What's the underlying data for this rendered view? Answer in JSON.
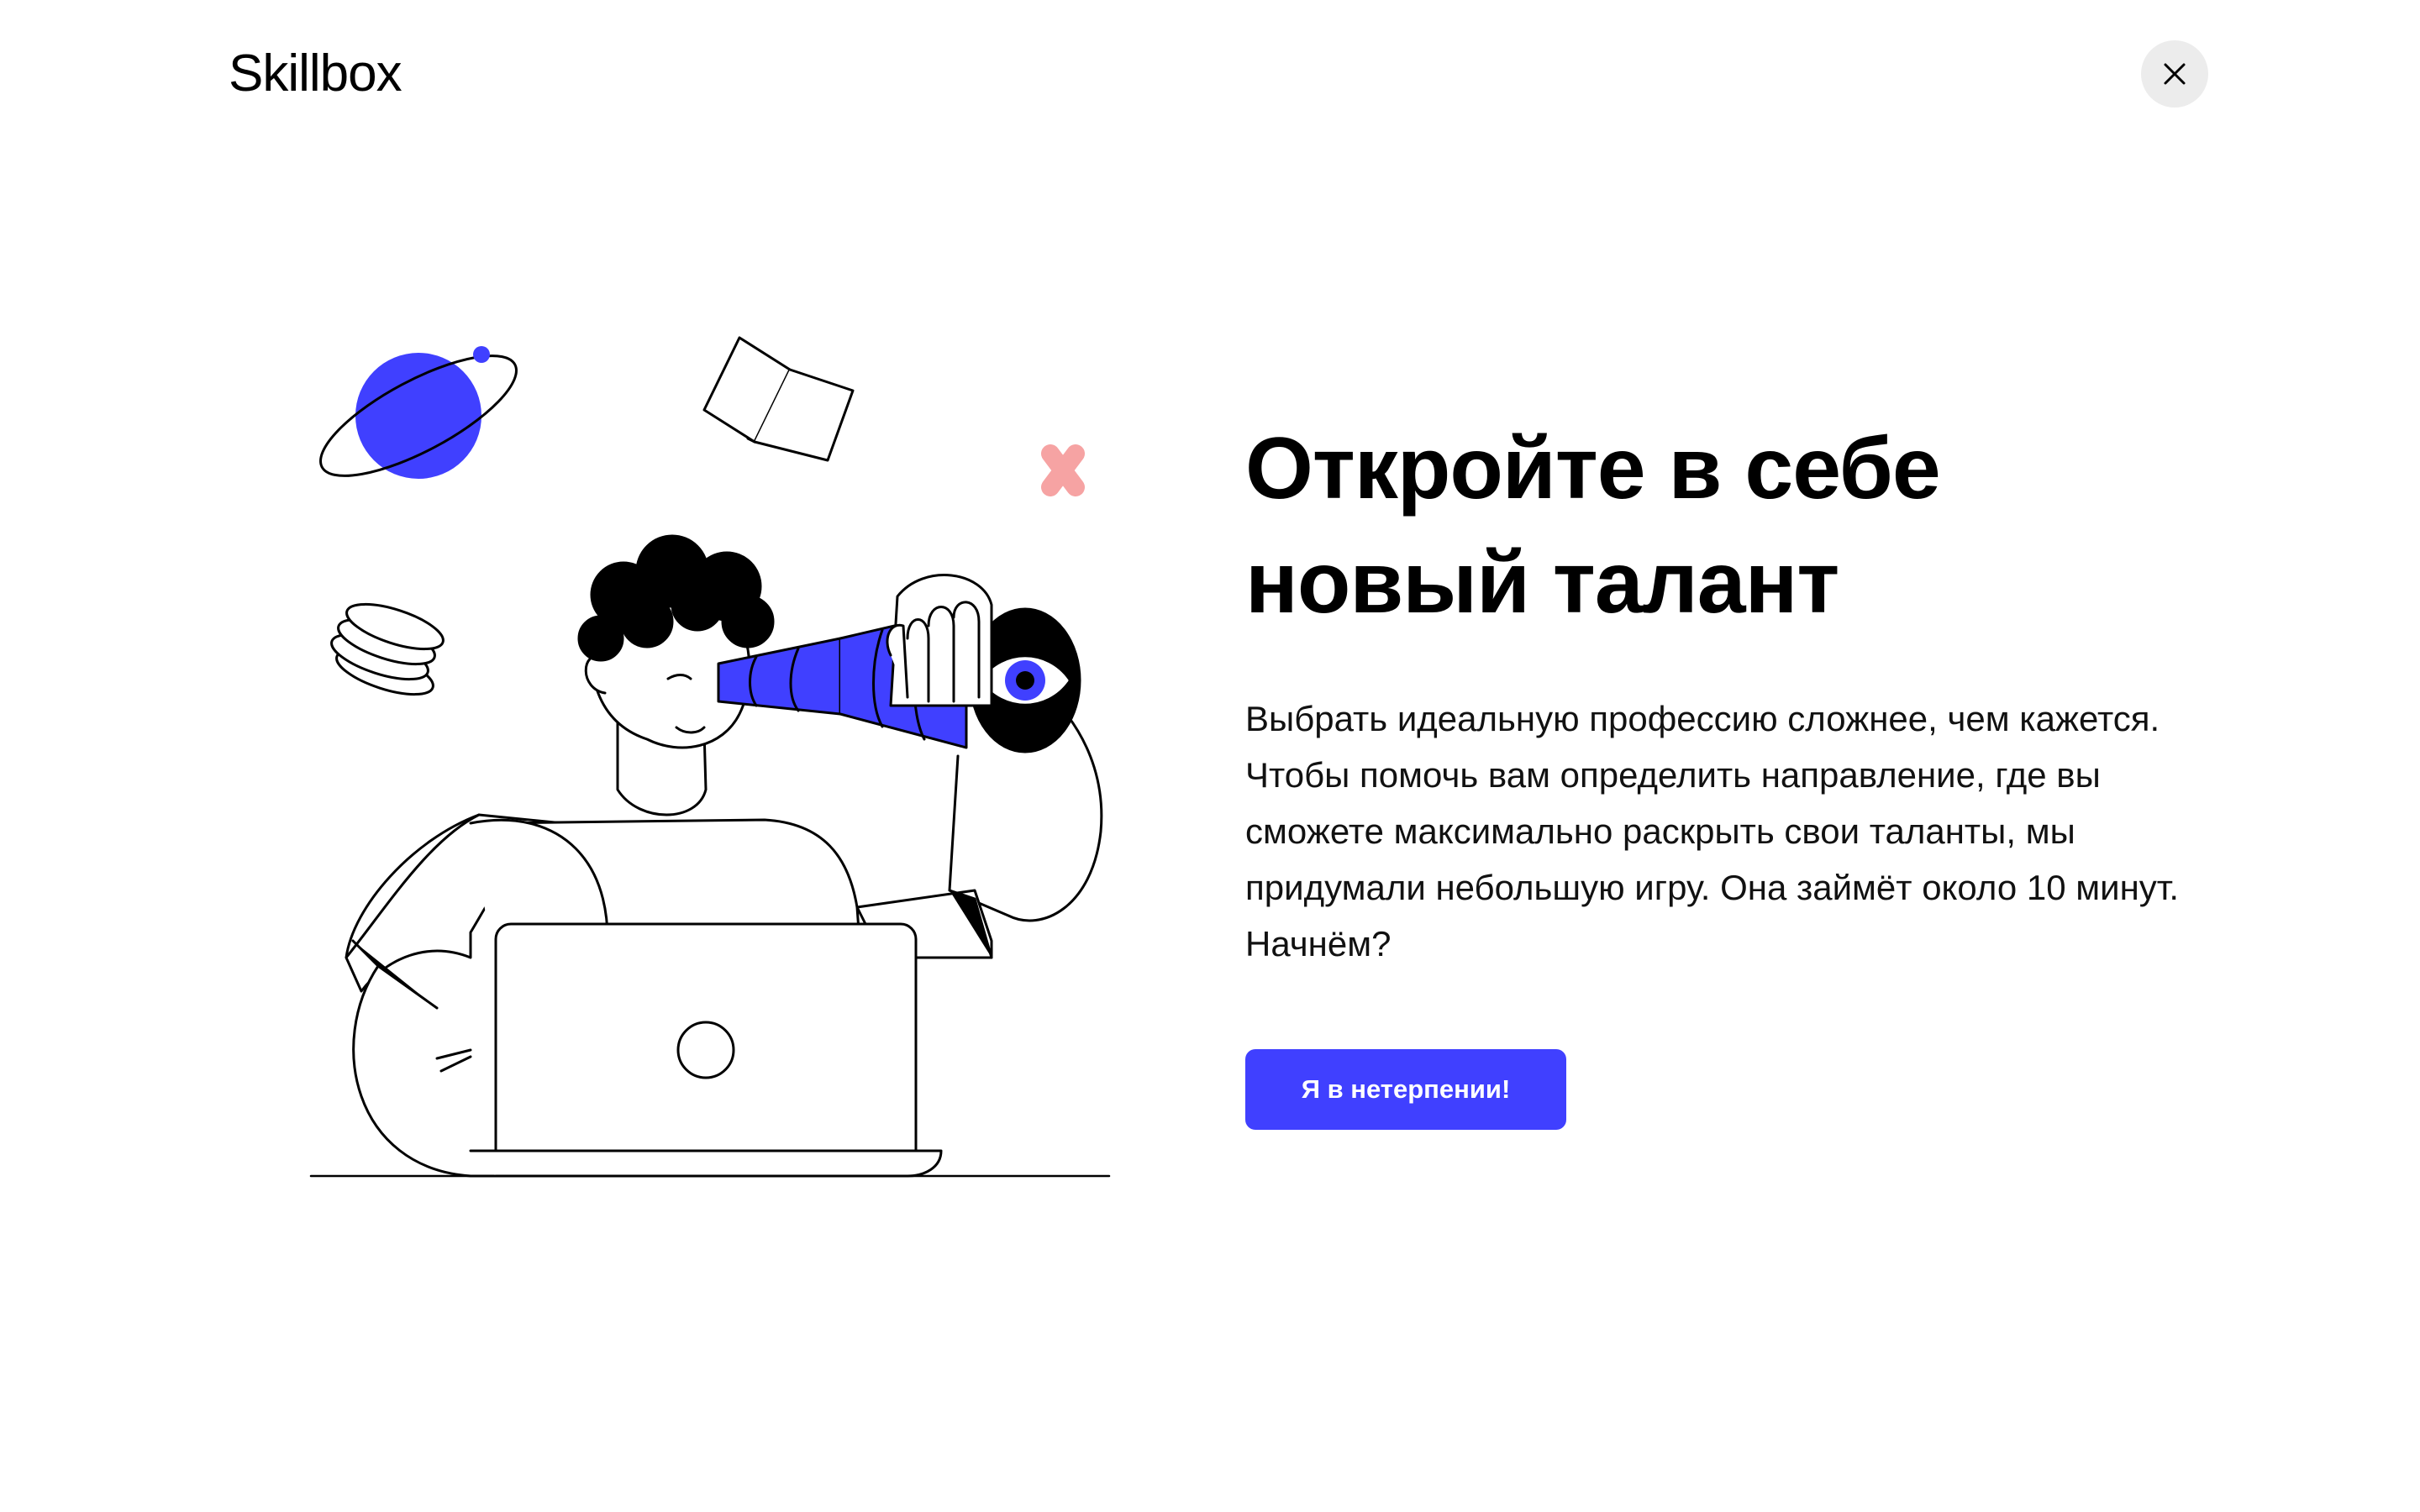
{
  "header": {
    "logo_text": "Skillbox",
    "close_icon": "close-icon"
  },
  "main": {
    "title": "Откройте в себе новый талант",
    "description": "Выбрать идеальную профессию сложнее, чем кажется. Чтобы помочь вам определить направление, где вы сможете максимально раскрыть свои таланты, мы придумали небольшую игру. Она займёт около 10 минут. Начнём?",
    "cta_label": "Я в нетерпении!"
  },
  "illustration": {
    "icon": "person-with-telescope-illustration"
  },
  "colors": {
    "accent": "#4040ff",
    "pink": "#f6a3a3",
    "close_bg": "#ececec",
    "text": "#000000"
  }
}
